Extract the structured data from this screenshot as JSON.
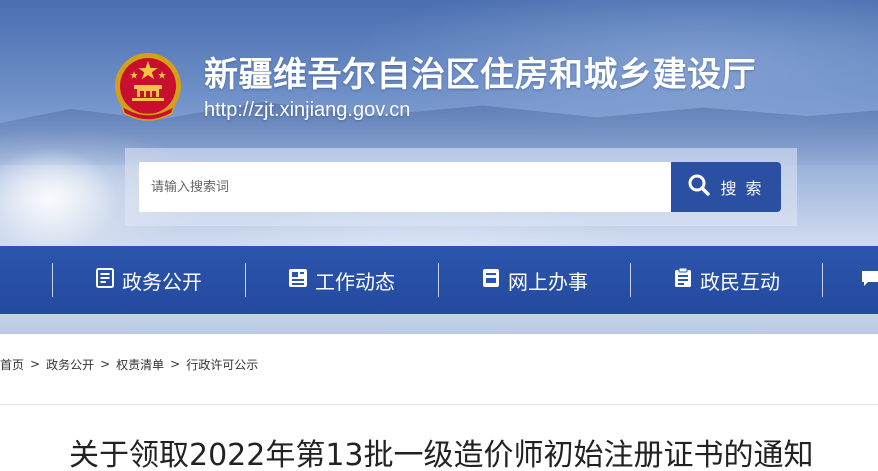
{
  "site": {
    "title": "新疆维吾尔自治区住房和城乡建设厅",
    "url": "http://zjt.xinjiang.gov.cn"
  },
  "search": {
    "placeholder": "请输入搜索词",
    "button_label": "搜 索"
  },
  "nav": {
    "items": [
      {
        "label": "政务公开",
        "icon": "document-list-icon"
      },
      {
        "label": "工作动态",
        "icon": "news-icon"
      },
      {
        "label": "网上办事",
        "icon": "form-icon"
      },
      {
        "label": "政民互动",
        "icon": "clipboard-icon"
      },
      {
        "label": "",
        "icon": "chat-icon"
      }
    ]
  },
  "breadcrumb": {
    "items": [
      "首页",
      "政务公开",
      "权责清单",
      "行政许可公示"
    ],
    "separator": ">"
  },
  "article": {
    "title": "关于领取2022年第13批一级造价师初始注册证书的通知"
  },
  "colors": {
    "nav_bg": "#2c55ad",
    "search_button_bg": "#2a4fa3",
    "title_text": "#222222"
  }
}
